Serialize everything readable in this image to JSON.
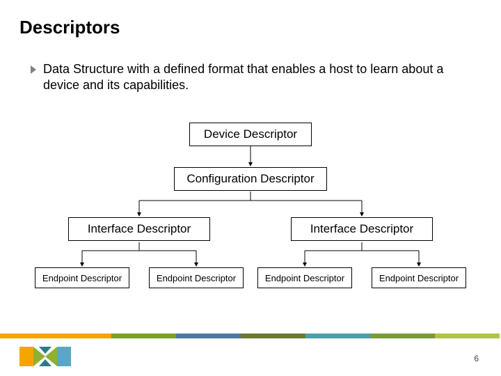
{
  "title": "Descriptors",
  "bullet": "Data Structure with a defined format that enables a host to learn about a device and its capabilities.",
  "nodes": {
    "device": "Device Descriptor",
    "config": "Configuration Descriptor",
    "iface1": "Interface Descriptor",
    "iface2": "Interface Descriptor",
    "ep1": "Endpoint Descriptor",
    "ep2": "Endpoint Descriptor",
    "ep3": "Endpoint Descriptor",
    "ep4": "Endpoint Descriptor"
  },
  "page_number": "6",
  "band_colors": [
    "#f5a500",
    "#7aa02c",
    "#4a7aa0",
    "#6b7a2f",
    "#4a9fa8",
    "#7a9a3a",
    "#b0c24a"
  ],
  "logo_colors": {
    "n": "#f5a500",
    "x": "#90b030",
    "p": "#5aa6c4",
    "triangle": "#2e7a82"
  }
}
